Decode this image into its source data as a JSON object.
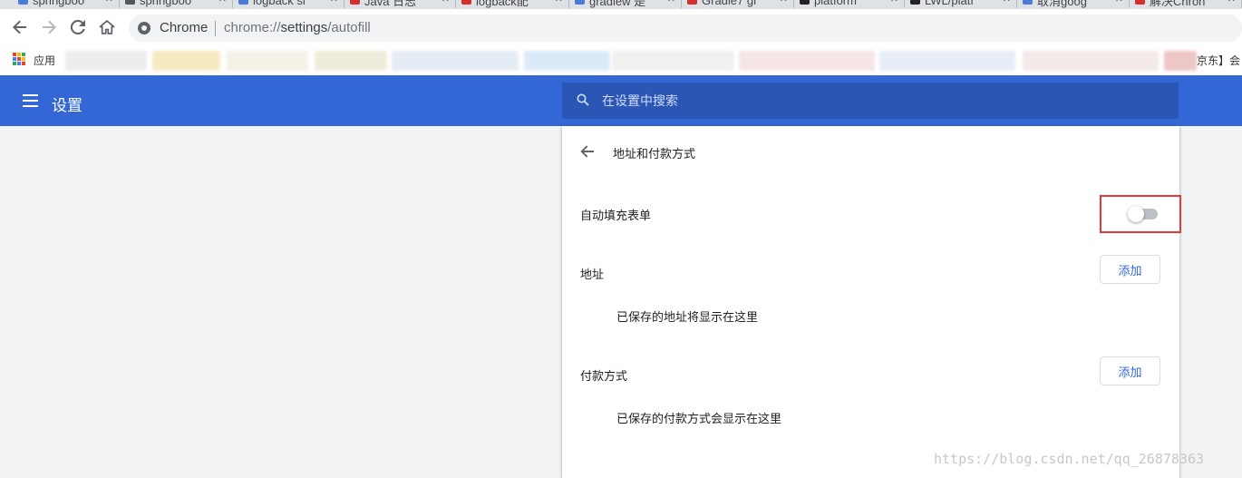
{
  "tabs": [
    {
      "title": "springboo",
      "color": "#4a7bd5"
    },
    {
      "title": "springboo",
      "color": "#555555"
    },
    {
      "title": "logback si",
      "color": "#4a7bd5"
    },
    {
      "title": "Java 日志",
      "color": "#d32f2f"
    },
    {
      "title": "logback配",
      "color": "#d32f2f"
    },
    {
      "title": "gradlew 是",
      "color": "#4a7bd5"
    },
    {
      "title": "Gradle7 gr",
      "color": "#d32f2f"
    },
    {
      "title": "platform",
      "color": "#222222"
    },
    {
      "title": "LWL/platf",
      "color": "#222222"
    },
    {
      "title": "取消goog",
      "color": "#4a7bd5"
    },
    {
      "title": "解决Chron",
      "color": "#d32f2f"
    }
  ],
  "toolbar": {
    "omnibox_scheme": "Chrome",
    "url_host": "chrome://",
    "url_path_bold": "settings",
    "url_rest": "/autofill"
  },
  "bookmarks": {
    "apps_label": "应用",
    "trailing_text": "京东】会"
  },
  "header": {
    "title": "设置",
    "search_placeholder": "在设置中搜索"
  },
  "page": {
    "subpage_title": "地址和付款方式",
    "autofill_label": "自动填充表单",
    "autofill_enabled": false,
    "addresses_label": "地址",
    "addresses_add": "添加",
    "addresses_empty": "已保存的地址将显示在这里",
    "payments_label": "付款方式",
    "payments_add": "添加",
    "payments_empty": "已保存的付款方式会显示在这里"
  },
  "watermark": "https://blog.csdn.net/qq_26878363",
  "colors": {
    "header_blue": "#3367d6",
    "search_blue": "#2a56b5",
    "highlight_red": "#e53935"
  }
}
